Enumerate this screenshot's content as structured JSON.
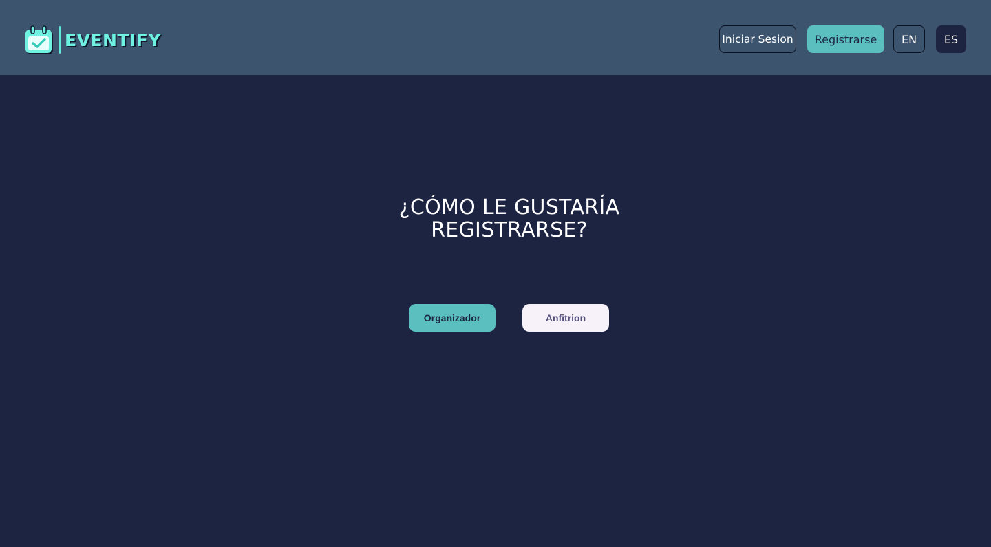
{
  "header": {
    "brand": "EVENTIFY",
    "logo_icon": "calendar-check-icon",
    "nav": {
      "login_label": "Iniciar Sesion",
      "register_label": "Registrarse",
      "lang_en_label": "EN",
      "lang_es_label": "ES",
      "active_language": "ES"
    }
  },
  "main": {
    "heading": "¿CÓMO LE GUSTARÍA REGISTRARSE?",
    "options": [
      {
        "label": "Organizador"
      },
      {
        "label": "Anfitrion"
      }
    ]
  },
  "colors": {
    "header_bg": "#3d546f",
    "page_bg": "#1d2442",
    "accent": "#5bbfbf",
    "brand_text": "#6ff2e2",
    "host_button_bg": "#f7f2fa"
  }
}
